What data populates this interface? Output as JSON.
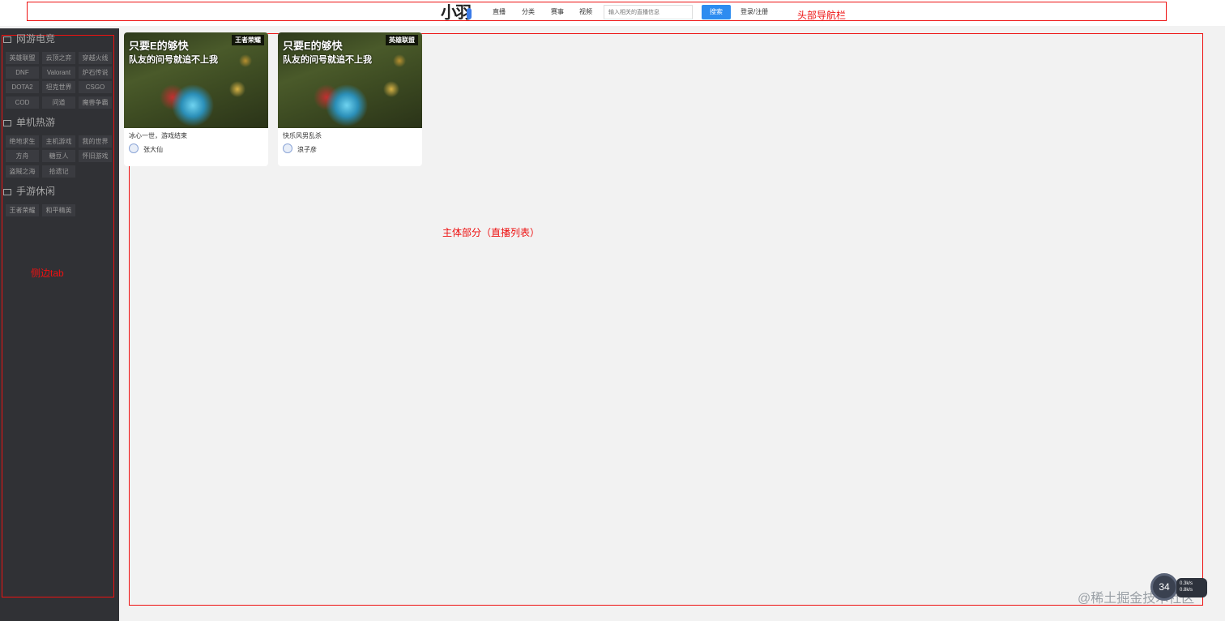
{
  "header": {
    "logo_text": "小羽",
    "nav": [
      "直播",
      "分类",
      "赛事",
      "视频"
    ],
    "search_placeholder": "输入相关的直播信息",
    "search_button": "搜索",
    "login": "登录/注册",
    "annotation": "头部导航栏"
  },
  "sidebar": {
    "annotation": "侧边tab",
    "sections": [
      {
        "title": "网游电竞",
        "icon": "monitor-icon",
        "tags": [
          "英雄联盟",
          "云顶之弈",
          "穿越火线",
          "DNF",
          "Valorant",
          "炉石传说",
          "DOTA2",
          "坦克世界",
          "CSGO",
          "COD",
          "问道",
          "魔兽争霸"
        ]
      },
      {
        "title": "单机热游",
        "icon": "gamepad-icon",
        "tags": [
          "绝地求生",
          "主机游戏",
          "我的世界",
          "方舟",
          "糖豆人",
          "怀旧游戏",
          "盗贼之海",
          "拾遗记"
        ]
      },
      {
        "title": "手游休闲",
        "icon": "phone-icon",
        "tags": [
          "王者荣耀",
          "和平精英"
        ]
      }
    ]
  },
  "main": {
    "annotation": "主体部分（直播列表）",
    "cards": [
      {
        "thumb_line1": "只要E的够快",
        "thumb_line2": "队友的问号就追不上我",
        "badge": "王者荣耀",
        "title": "冰心一世，游戏结束",
        "author": "张大仙"
      },
      {
        "thumb_line1": "只要E的够快",
        "thumb_line2": "队友的问号就追不上我",
        "badge": "英雄联盟",
        "title": "快乐风男乱杀",
        "author": "浪子彦"
      }
    ]
  },
  "overlay": {
    "watermark": "@稀土掘金技术社区",
    "speed_percent": "34",
    "speed_value": "0.3k/s",
    "speed_value2": "0.8k/s"
  }
}
